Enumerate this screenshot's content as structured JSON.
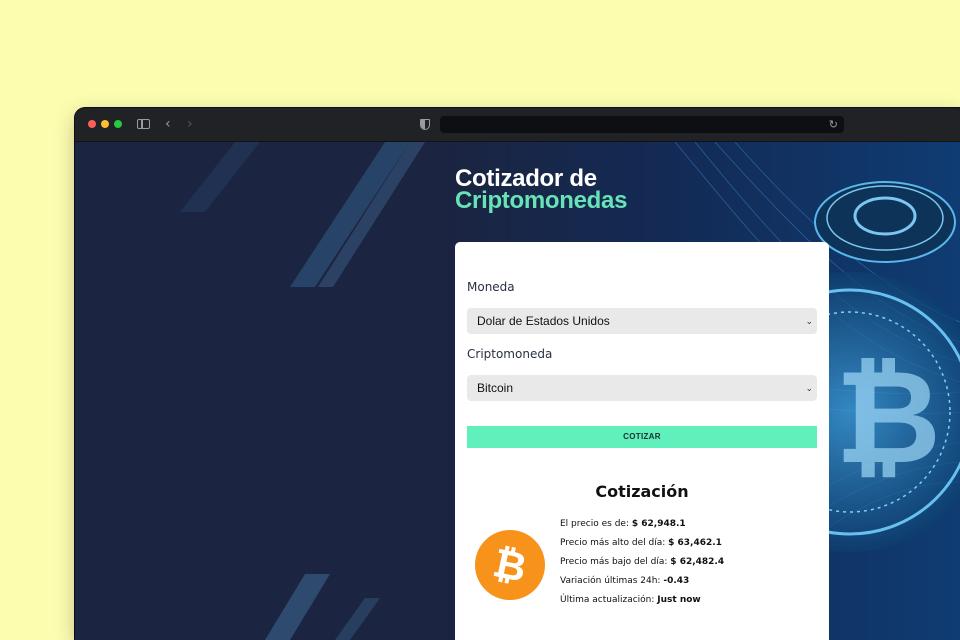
{
  "browser": {
    "icons": {
      "close": "red-dot",
      "minimize": "yellow-dot",
      "maximize": "green-dot",
      "sidebar": "sidebar-toggle-icon",
      "back": "chevron-left-icon",
      "forward": "chevron-right-icon",
      "privacy": "shield-icon",
      "reload": "reload-icon"
    },
    "url": ""
  },
  "page": {
    "title_line1": "Cotizador de",
    "title_line2": "Criptomonedas",
    "form": {
      "currency_label": "Moneda",
      "currency_value": "Dolar de Estados Unidos",
      "crypto_label": "Criptomoneda",
      "crypto_value": "Bitcoin",
      "submit_label": "COTIZAR"
    },
    "result": {
      "title": "Cotización",
      "coin_icon": "bitcoin-icon",
      "rows": [
        {
          "label": "El precio es de: ",
          "value": "$ 62,948.1"
        },
        {
          "label": "Precio más alto del día: ",
          "value": "$ 63,462.1"
        },
        {
          "label": "Precio más bajo del día: ",
          "value": "$ 62,482.4"
        },
        {
          "label": "Variación últimas 24h: ",
          "value": "-0.43"
        },
        {
          "label": "Última actualización: ",
          "value": "Just now"
        }
      ]
    }
  },
  "colors": {
    "page_bg": "#fdfdb0",
    "app_bg": "#1b2440",
    "accent": "#66e3b7",
    "button": "#5ff0bb",
    "coin": "#f7931a"
  }
}
